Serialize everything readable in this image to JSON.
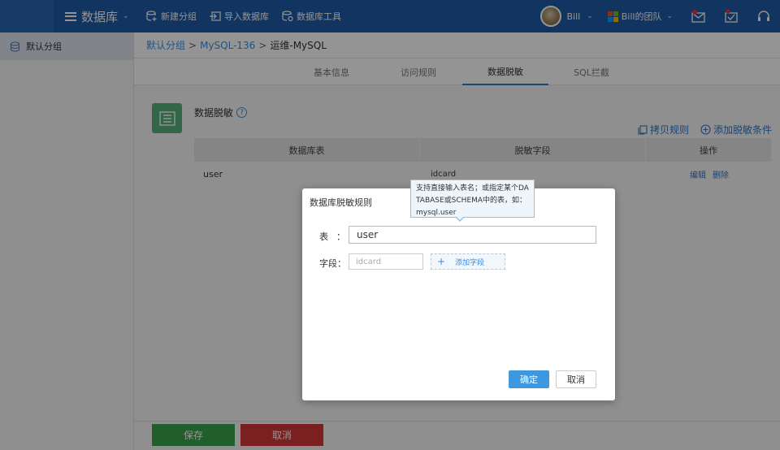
{
  "header": {
    "app_title": "数据库",
    "actions": [
      {
        "label": "新建分组",
        "icon": "new-group-icon"
      },
      {
        "label": "导入数据库",
        "icon": "import-icon"
      },
      {
        "label": "数据库工具",
        "icon": "db-tools-icon"
      }
    ],
    "user_name": "Bill",
    "team_name": "Bill的团队",
    "team_colors": [
      "#f25022",
      "#7fba00",
      "#00a4ef",
      "#ffb900"
    ],
    "right_icons": [
      "notification-icon",
      "message-icon",
      "headset-icon"
    ]
  },
  "sidebar": {
    "items": [
      {
        "label": "默认分组",
        "icon": "database-icon"
      }
    ]
  },
  "breadcrumb": {
    "items": [
      "默认分组",
      "MySQL-136"
    ],
    "current": "运维-MySQL",
    "separator": ">"
  },
  "tabs": [
    {
      "label": "基本信息",
      "active": false
    },
    {
      "label": "访问规则",
      "active": false
    },
    {
      "label": "数据脱敏",
      "active": true
    },
    {
      "label": "SQL拦截",
      "active": false
    }
  ],
  "section": {
    "title": "数据脱敏",
    "help": "?",
    "copy_rule": "拷贝规则",
    "add_condition": "添加脱敏条件"
  },
  "table": {
    "columns": [
      "数据库表",
      "脱敏字段",
      "操作"
    ],
    "rows": [
      {
        "table": "user",
        "field": "idcard",
        "edit": "编辑",
        "delete": "删除"
      }
    ]
  },
  "footer": {
    "save": "保存",
    "cancel": "取消"
  },
  "modal": {
    "title": "数据库脱敏规则",
    "table_label": "表",
    "table_colon": "：",
    "table_value": "user",
    "field_label": "字段：",
    "field_placeholder": "idcard",
    "add_field": "添加字段",
    "add_field_plus": "+",
    "ok": "确定",
    "cancel": "取消"
  },
  "tooltip": {
    "text": "支持直接输入表名；或指定某个DATABASE或SCHEMA中的表，如：mysql.user"
  },
  "colors": {
    "nav": "#1e5aa8",
    "save": "#3aa34a",
    "cancel": "#d23737",
    "primary": "#3d98e0",
    "link": "#2f77c7"
  }
}
